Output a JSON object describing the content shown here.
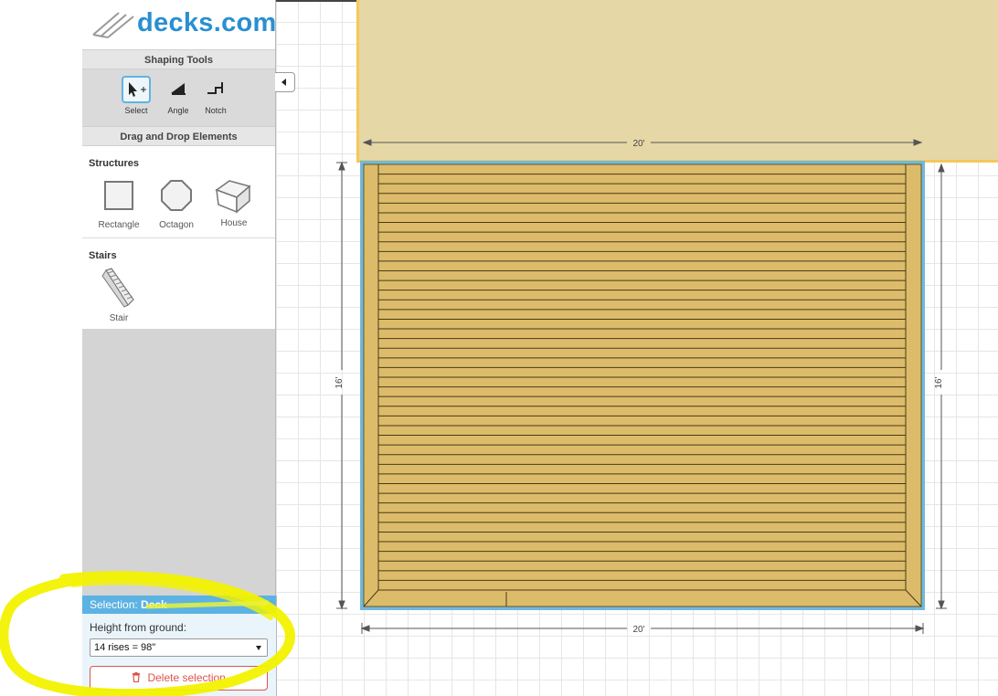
{
  "brand": {
    "name": "decks.com"
  },
  "shaping_tools": {
    "title": "Shaping Tools",
    "tools": [
      {
        "label": "Select",
        "icon": "select-cursor-icon",
        "active": true
      },
      {
        "label": "Angle",
        "icon": "angle-icon",
        "active": false
      },
      {
        "label": "Notch",
        "icon": "notch-icon",
        "active": false
      }
    ]
  },
  "drag_drop": {
    "title": "Drag and Drop Elements",
    "structures": {
      "title": "Structures",
      "items": [
        {
          "label": "Rectangle",
          "icon": "rectangle-icon"
        },
        {
          "label": "Octagon",
          "icon": "octagon-icon"
        },
        {
          "label": "House",
          "icon": "house-icon"
        }
      ]
    },
    "stairs": {
      "title": "Stairs",
      "items": [
        {
          "label": "Stair",
          "icon": "stair-icon"
        }
      ]
    }
  },
  "selection": {
    "prefix": "Selection:",
    "type": "Deck",
    "height_label": "Height from ground:",
    "height_value": "14 rises = 98\"",
    "delete_label": "Delete selection"
  },
  "canvas": {
    "dim_top": "20'",
    "dim_bottom": "20'",
    "dim_left": "16'",
    "dim_right": "16'",
    "deck_board_count": 44
  },
  "colors": {
    "accent": "#5cb2e2",
    "brand": "#2a8fd0",
    "deck_wood": "#dcbc6a",
    "house_fill": "#e6d7a6",
    "house_outline": "#f3c95a",
    "delete": "#e0524d",
    "highlight_marker": "#f2f200"
  }
}
